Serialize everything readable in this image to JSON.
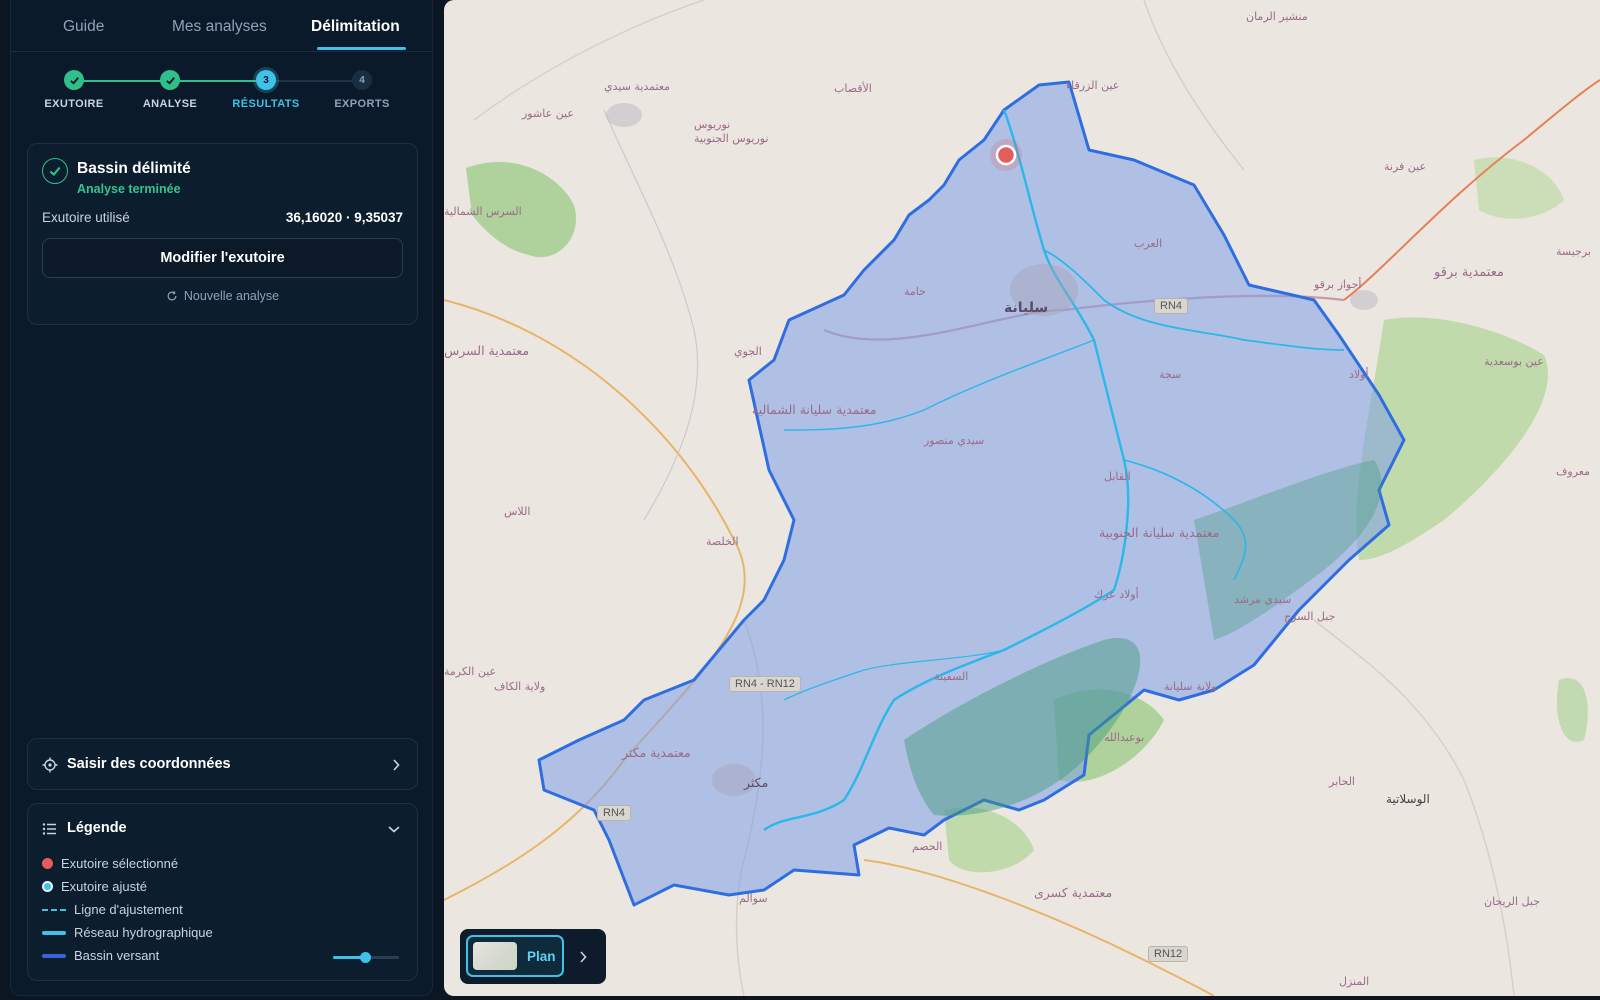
{
  "tabs": [
    {
      "label": "Guide"
    },
    {
      "label": "Mes analyses"
    },
    {
      "label": "Délimitation"
    }
  ],
  "stepper": [
    {
      "label": "EXUTOIRE",
      "state": "done",
      "number": "1"
    },
    {
      "label": "ANALYSE",
      "state": "done",
      "number": "2"
    },
    {
      "label": "RÉSULTATS",
      "state": "current",
      "number": "3"
    },
    {
      "label": "EXPORTS",
      "state": "pending",
      "number": "4"
    }
  ],
  "status": {
    "title": "Bassin délimité",
    "subtitle": "Analyse terminée",
    "outlet_label": "Exutoire utilisé",
    "outlet_value": "36,16020 · 9,35037",
    "modify_label": "Modifier l'exutoire",
    "new_analysis_label": "Nouvelle analyse"
  },
  "coords": {
    "label": "Saisir des coordonnées"
  },
  "legend": {
    "title": "Légende",
    "items": [
      {
        "label": "Exutoire sélectionné",
        "symbol": "dot",
        "color": "#e35d5d"
      },
      {
        "label": "Exutoire ajusté",
        "symbol": "ring-dot",
        "color": "#3fc1e8"
      },
      {
        "label": "Ligne d'ajustement",
        "symbol": "dashed",
        "color": "#3fc1e8"
      },
      {
        "label": "Réseau hydrographique",
        "symbol": "thick-line",
        "color": "#3fc1e8"
      },
      {
        "label": "Bassin versant",
        "symbol": "line",
        "color": "#3b63d6"
      }
    ],
    "opacity_slider_value": 0.5
  },
  "map": {
    "layer_label": "Plan",
    "labels": [
      "منشير الرمان",
      "معتمدية سيدي",
      "عين عاشور",
      "نوريوس",
      "نوريوس الجنوبية",
      "الأقصاب",
      "عين الزرقاء",
      "السرس الشمالية",
      "حامة",
      "سليانة",
      "العرب",
      "معتمدية برقو",
      "أحواز برقو",
      "معتمدية السرس",
      "الجوي",
      "معتمدية سليانة الشمالية",
      "سيدي منصور",
      "سجة",
      "أولاد",
      "عين بوسعدية",
      "اللاس",
      "الخلصة",
      "القابل",
      "معتمدية سليانة الجنوبية",
      "سيدي مرشد",
      "أولاد عرك",
      "جبل السرج",
      "عين فرنة",
      "السفينة",
      "ولاية الكاف",
      "معتمدية مكثر",
      "مكثر",
      "عين الكرمة",
      "بوعبدالله",
      "الحابر",
      "الوسلاتية",
      "معتمدية كسرى",
      "جبل الريحان",
      "سوالم",
      "المنزل",
      "الحصم",
      "معروف",
      "برجيسة",
      "ولاية سليانة"
    ],
    "roads": [
      "RN4",
      "RN4 - RN12",
      "RN4",
      "RN12"
    ],
    "colors": {
      "basin_fill": "#7f9fe8",
      "basin_stroke": "#2f6ee0",
      "river": "#2bb7e8",
      "outlet": "#e35d5d"
    }
  }
}
